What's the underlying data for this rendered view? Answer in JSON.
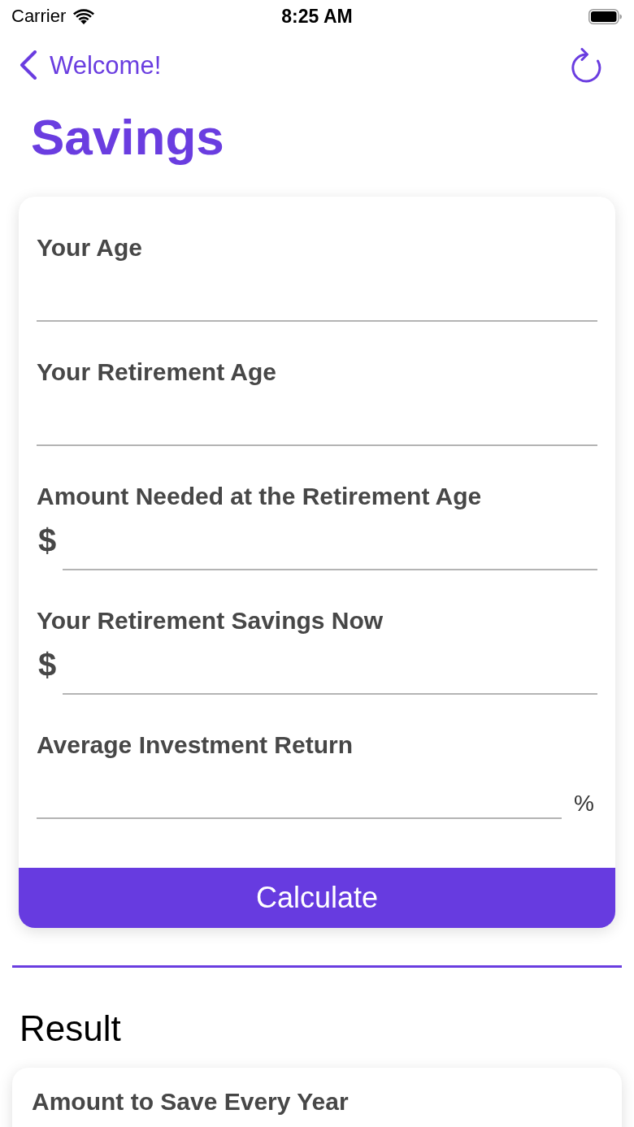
{
  "status_bar": {
    "carrier": "Carrier",
    "time": "8:25 AM"
  },
  "nav": {
    "back_label": "Welcome!"
  },
  "title": "Savings",
  "form": {
    "fields": [
      {
        "label": "Your Age"
      },
      {
        "label": "Your Retirement Age"
      },
      {
        "label": "Amount Needed at the Retirement Age",
        "prefix": "$"
      },
      {
        "label": "Your Retirement Savings Now",
        "prefix": "$"
      },
      {
        "label": "Average Investment Return",
        "suffix": "%"
      }
    ],
    "button": "Calculate"
  },
  "result": {
    "heading": "Result",
    "items": [
      {
        "label": "Amount to Save Every Year"
      }
    ]
  }
}
